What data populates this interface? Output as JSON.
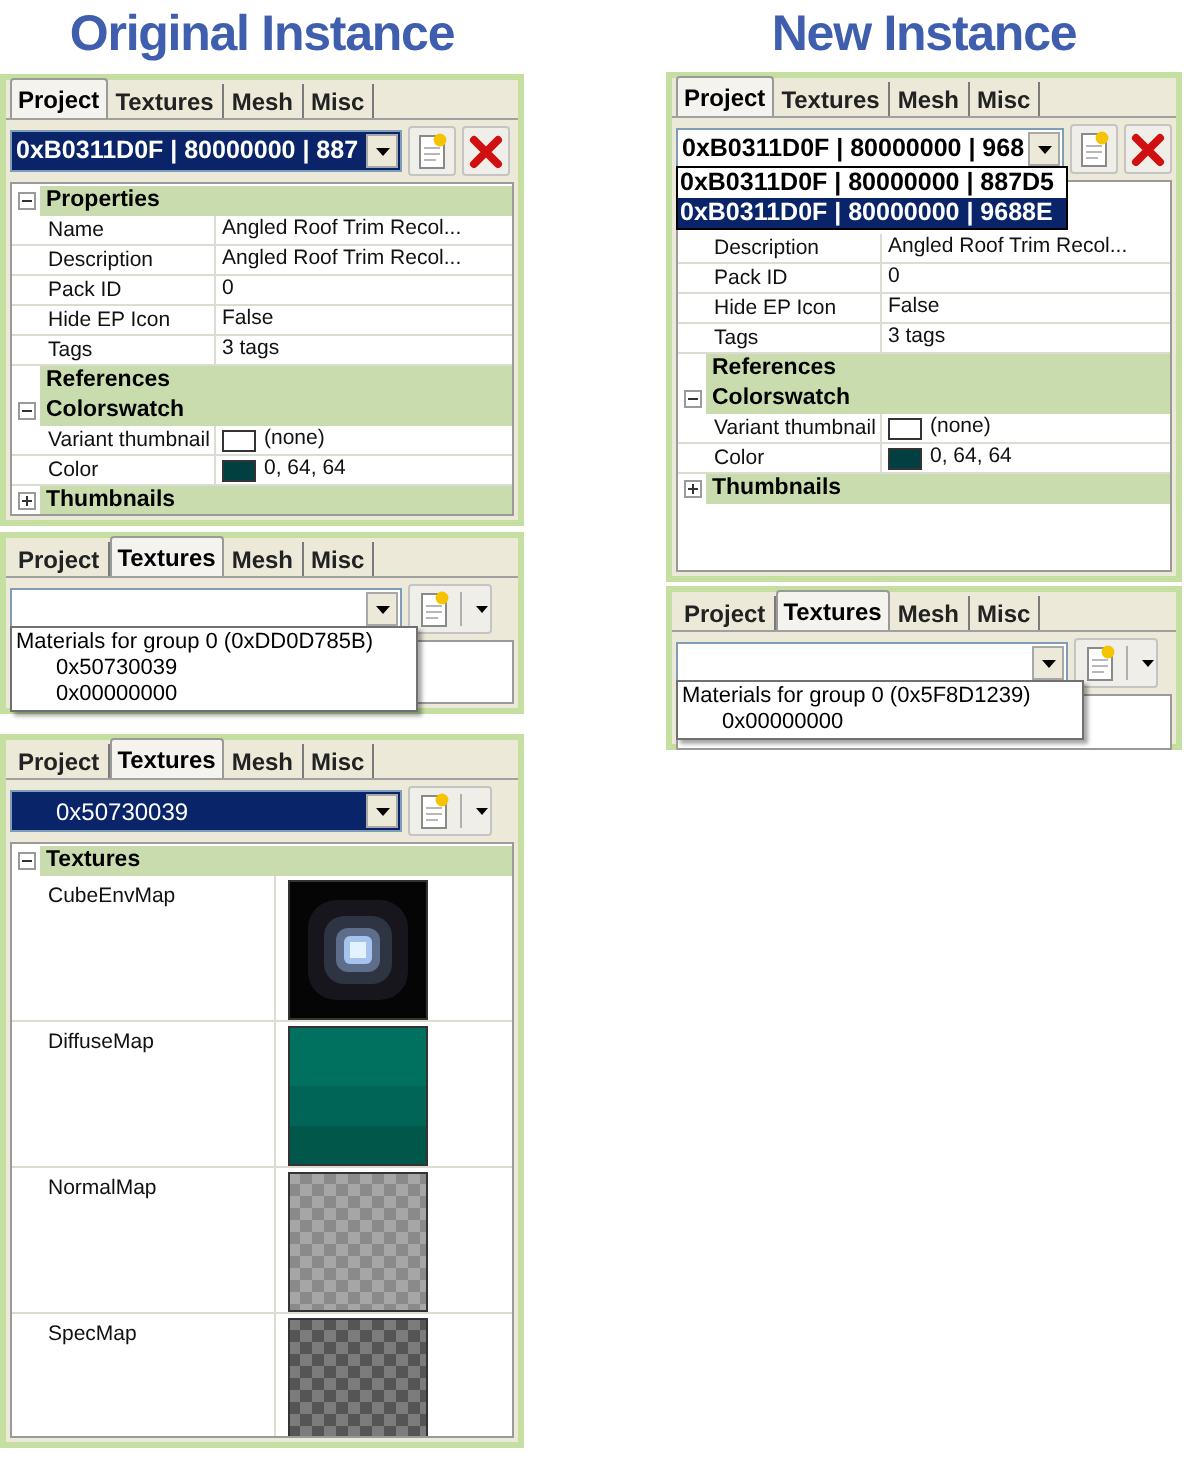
{
  "sections": [
    {
      "heading": "Original Instance",
      "panels": [
        {
          "tabs": [
            {
              "label": "Project",
              "selected": true
            },
            {
              "label": "Textures",
              "selected": false
            },
            {
              "label": "Mesh",
              "selected": false
            },
            {
              "label": "Misc",
              "selected": false
            }
          ],
          "combo": {
            "value": "0xB0311D0F | 80000000 | 887",
            "highlighted": true
          },
          "tool_buttons": [
            {
              "kind": "new"
            },
            {
              "kind": "delete"
            }
          ],
          "grid": {
            "kind": "properties",
            "categories": [
              {
                "label": "Properties",
                "expanded": true,
                "rows": [
                  {
                    "label": "Name",
                    "value": "Angled Roof Trim Recol..."
                  },
                  {
                    "label": "Description",
                    "value": "Angled Roof Trim Recol..."
                  },
                  {
                    "label": "Pack ID",
                    "value": "0"
                  },
                  {
                    "label": "Hide EP Icon",
                    "value": "False"
                  },
                  {
                    "label": "Tags",
                    "value": "3 tags"
                  }
                ]
              },
              {
                "label": "References"
              },
              {
                "label": "Colorswatch",
                "expanded": true,
                "rows": [
                  {
                    "label": "Variant thumbnail",
                    "value": "(none)",
                    "color": "#ffffff"
                  },
                  {
                    "label": "Color",
                    "value": "0, 64, 64",
                    "color": "#004040"
                  }
                ]
              },
              {
                "label": "Thumbnails",
                "expanded": false
              }
            ]
          }
        },
        {
          "tabs": [
            {
              "label": "Project",
              "selected": false
            },
            {
              "label": "Textures",
              "selected": true
            },
            {
              "label": "Mesh",
              "selected": false
            },
            {
              "label": "Misc",
              "selected": false
            }
          ],
          "combo": {
            "highlighted": false
          },
          "tool_buttons": [
            {
              "kind": "new_menu"
            }
          ],
          "dropdown": {
            "kind": "tree",
            "items": [
              {
                "text": "Materials for group 0 (0xDD0D785B)",
                "children": [
                  {
                    "text": "0x50730039"
                  },
                  {
                    "text": "0x00000000"
                  }
                ]
              }
            ]
          }
        },
        {
          "tabs": [
            {
              "label": "Project",
              "selected": false
            },
            {
              "label": "Textures",
              "selected": true
            },
            {
              "label": "Mesh",
              "selected": false
            },
            {
              "label": "Misc",
              "selected": false
            }
          ],
          "combo": {
            "value": "0x50730039",
            "highlighted": true
          },
          "tool_buttons": [
            {
              "kind": "new_menu"
            }
          ],
          "grid": {
            "kind": "textures",
            "categories": [
              {
                "label": "Textures",
                "expanded": true,
                "rows": [
                  {
                    "label": "CubeEnvMap",
                    "kind": "picture"
                  },
                  {
                    "label": "DiffuseMap",
                    "kind": "picture"
                  },
                  {
                    "label": "NormalMap",
                    "kind": "picture"
                  },
                  {
                    "label": "SpecMap",
                    "kind": "picture"
                  }
                ]
              }
            ]
          }
        }
      ]
    },
    {
      "heading": "New Instance",
      "panels": [
        {
          "tabs": [
            {
              "label": "Project",
              "selected": true
            },
            {
              "label": "Textures",
              "selected": false
            },
            {
              "label": "Mesh",
              "selected": false
            },
            {
              "label": "Misc",
              "selected": false
            }
          ],
          "combo": {
            "value": "0xB0311D0F | 80000000 | 968",
            "highlighted": false
          },
          "tool_buttons": [
            {
              "kind": "new"
            },
            {
              "kind": "delete"
            }
          ],
          "dropdown": {
            "kind": "list",
            "items": [
              {
                "text": "0xB0311D0F | 80000000 | 887D5",
                "selected": false
              },
              {
                "text": "0xB0311D0F | 80000000 | 9688E",
                "selected": true
              }
            ]
          },
          "grid": {
            "kind": "properties",
            "categories": [
              {
                "rows": [
                  {
                    "label": "Description",
                    "value": "Angled Roof Trim Recol..."
                  },
                  {
                    "label": "Pack ID",
                    "value": "0"
                  },
                  {
                    "label": "Hide EP Icon",
                    "value": "False"
                  },
                  {
                    "label": "Tags",
                    "value": "3 tags"
                  }
                ]
              },
              {
                "label": "References"
              },
              {
                "label": "Colorswatch",
                "expanded": true,
                "rows": [
                  {
                    "label": "Variant thumbnail",
                    "value": "(none)",
                    "color": "#ffffff"
                  },
                  {
                    "label": "Color",
                    "value": "0, 64, 64",
                    "color": "#004040"
                  }
                ]
              },
              {
                "label": "Thumbnails",
                "expanded": false
              }
            ]
          }
        },
        {
          "tabs": [
            {
              "label": "Project",
              "selected": false
            },
            {
              "label": "Textures",
              "selected": true
            },
            {
              "label": "Mesh",
              "selected": false
            },
            {
              "label": "Misc",
              "selected": false
            }
          ],
          "combo": {
            "highlighted": false
          },
          "tool_buttons": [
            {
              "kind": "new_menu"
            }
          ],
          "dropdown": {
            "kind": "tree",
            "items": [
              {
                "text": "Materials for group 0 (0x5F8D1239)",
                "children": [
                  {
                    "text": "0x00000000"
                  }
                ]
              }
            ]
          }
        }
      ]
    }
  ]
}
